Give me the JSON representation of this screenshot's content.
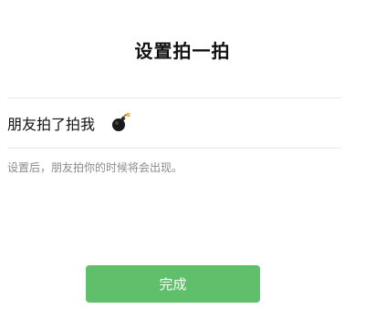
{
  "header": {
    "title": "设置拍一拍"
  },
  "pat_setting": {
    "prefix_label": "朋友拍了拍我",
    "suffix_icon": "bomb-icon"
  },
  "hint": {
    "text": "设置后，朋友拍你的时候将会出现。"
  },
  "footer": {
    "done_label": "完成"
  },
  "colors": {
    "button_green": "#5fbf6b",
    "hint_gray": "#8a8a8a",
    "divider": "#e8e8e8"
  }
}
